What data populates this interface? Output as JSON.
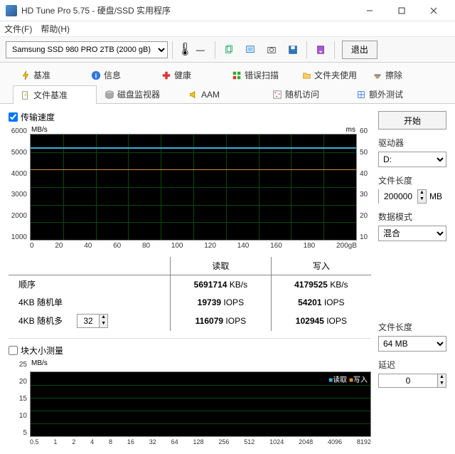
{
  "window": {
    "title": "HD Tune Pro 5.75 - 硬盘/SSD 实用程序"
  },
  "menu": {
    "file": "文件(F)",
    "help": "帮助(H)"
  },
  "toolbar": {
    "device": "Samsung SSD 980 PRO 2TB (2000 gB)",
    "temp": "—",
    "exit": "退出"
  },
  "tabs": {
    "row1": [
      {
        "label": "基准",
        "icon": "bolt"
      },
      {
        "label": "信息",
        "icon": "info"
      },
      {
        "label": "健康",
        "icon": "plus"
      },
      {
        "label": "错误扫描",
        "icon": "scan"
      },
      {
        "label": "文件夹使用",
        "icon": "folder"
      },
      {
        "label": "擦除",
        "icon": "erase"
      }
    ],
    "row2": [
      {
        "label": "文件基准",
        "icon": "filebench",
        "active": true
      },
      {
        "label": "磁盘监视器",
        "icon": "disk"
      },
      {
        "label": "AAM",
        "icon": "speaker"
      },
      {
        "label": "随机访问",
        "icon": "random"
      },
      {
        "label": "额外测试",
        "icon": "extra"
      }
    ]
  },
  "transfer": {
    "checkbox_label": "传输速度",
    "checked": true,
    "y_unit": "MB/s",
    "y2_unit": "ms",
    "y_ticks": [
      "6000",
      "5000",
      "4000",
      "3000",
      "2000",
      "1000"
    ],
    "y2_ticks": [
      "60",
      "50",
      "40",
      "30",
      "20",
      "10"
    ],
    "x_ticks": [
      "0",
      "20",
      "40",
      "60",
      "80",
      "100",
      "120",
      "140",
      "160",
      "180",
      "200gB"
    ]
  },
  "chart_data": {
    "type": "line",
    "title": "传输速度",
    "xlabel": "gB",
    "ylabel": "MB/s",
    "y2label": "ms",
    "xlim": [
      0,
      200
    ],
    "ylim": [
      0,
      6000
    ],
    "y2lim": [
      0,
      60
    ],
    "x": [
      0,
      20,
      40,
      60,
      80,
      100,
      120,
      140,
      160,
      180,
      200
    ],
    "series": [
      {
        "name": "读取 (MB/s)",
        "values": [
          5300,
          5400,
          5350,
          5300,
          5350,
          5300,
          5400,
          5350,
          5300,
          5350,
          5300
        ]
      },
      {
        "name": "写入 (MB/s)",
        "values": [
          4050,
          4000,
          4050,
          4000,
          4050,
          4000,
          4050,
          4000,
          4050,
          4000,
          4050
        ]
      }
    ]
  },
  "results": {
    "read_hdr": "读取",
    "write_hdr": "写入",
    "rows": [
      {
        "label": "顺序",
        "read_val": "5691714",
        "read_unit": "KB/s",
        "write_val": "4179525",
        "write_unit": "KB/s"
      },
      {
        "label": "4KB 随机单",
        "read_val": "19739",
        "read_unit": "IOPS",
        "write_val": "54201",
        "write_unit": "IOPS"
      },
      {
        "label": "4KB 随机多",
        "read_val": "116079",
        "read_unit": "IOPS",
        "write_val": "102945",
        "write_unit": "IOPS"
      }
    ],
    "threads": "32"
  },
  "blocksize": {
    "checkbox_label": "块大小测量",
    "checked": false,
    "y_unit": "MB/s",
    "y_ticks": [
      "25",
      "20",
      "15",
      "10",
      "5"
    ],
    "x_ticks": [
      "0.5",
      "1",
      "2",
      "4",
      "8",
      "16",
      "32",
      "64",
      "128",
      "256",
      "512",
      "1024",
      "2048",
      "4096",
      "8192"
    ],
    "legend_read": "读取",
    "legend_write": "写入"
  },
  "side": {
    "start": "开始",
    "drive_label": "驱动器",
    "drive_value": "D:",
    "filelen_label": "文件长度",
    "filelen_value": "200000",
    "filelen_unit": "MB",
    "mode_label": "数据模式",
    "mode_value": "混合",
    "filelen2_label": "文件长度",
    "filelen2_value": "64 MB",
    "delay_label": "延迟",
    "delay_value": "0"
  }
}
